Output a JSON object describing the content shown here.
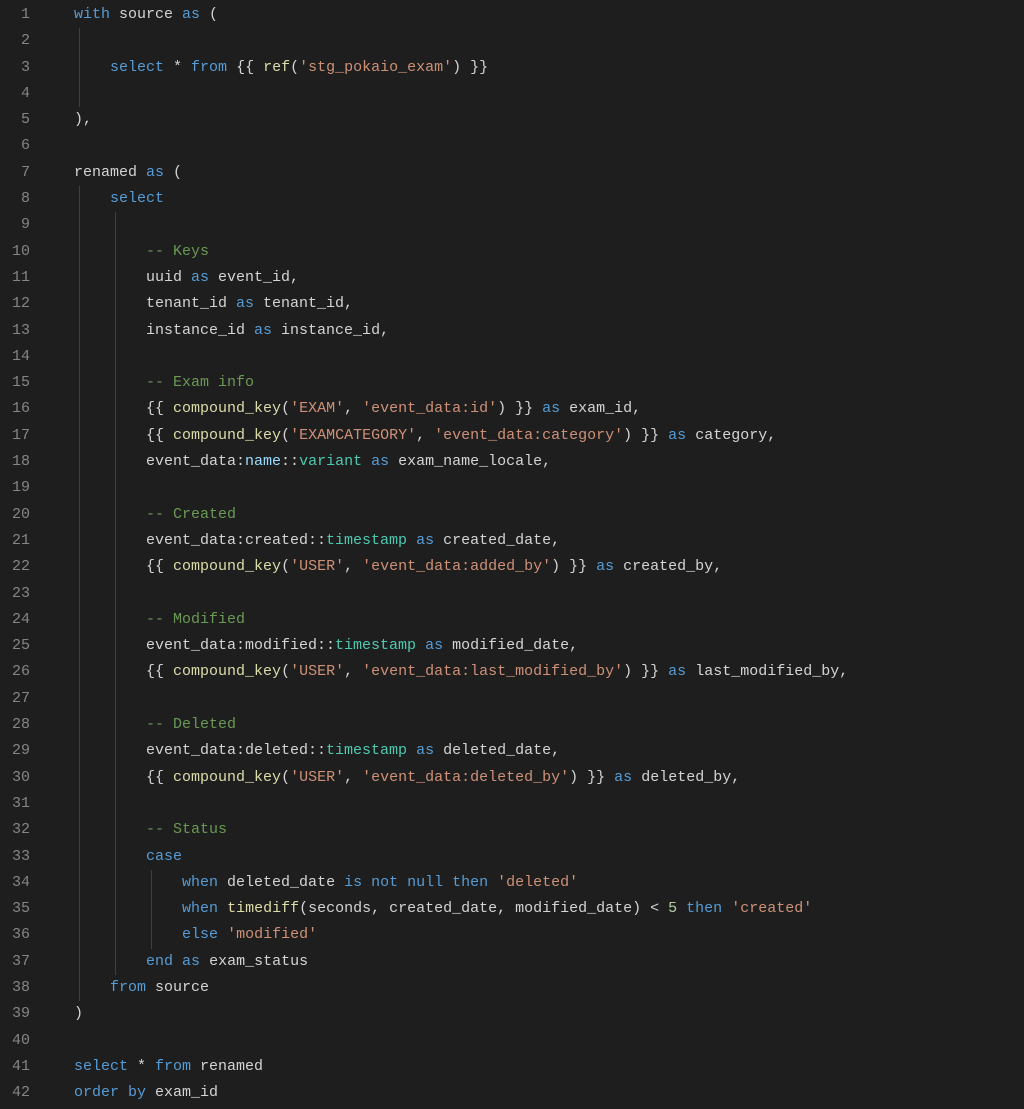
{
  "lineCount": 42,
  "lines": [
    [
      [
        "kw",
        "with"
      ],
      [
        "dim",
        " source "
      ],
      [
        "kw",
        "as"
      ],
      [
        "dim",
        " ("
      ]
    ],
    [],
    [
      [
        "dim",
        "    "
      ],
      [
        "kw",
        "select"
      ],
      [
        "dim",
        " * "
      ],
      [
        "kw",
        "from"
      ],
      [
        "dim",
        " {{ "
      ],
      [
        "fn",
        "ref"
      ],
      [
        "dim",
        "("
      ],
      [
        "str",
        "'stg_pokaio_exam'"
      ],
      [
        "dim",
        ") }}"
      ]
    ],
    [],
    [
      [
        "dim",
        "),"
      ]
    ],
    [],
    [
      [
        "dim",
        "renamed "
      ],
      [
        "kw",
        "as"
      ],
      [
        "dim",
        " ("
      ]
    ],
    [
      [
        "dim",
        "    "
      ],
      [
        "kw",
        "select"
      ]
    ],
    [],
    [
      [
        "dim",
        "        "
      ],
      [
        "cm",
        "-- Keys"
      ]
    ],
    [
      [
        "dim",
        "        uuid "
      ],
      [
        "kw",
        "as"
      ],
      [
        "dim",
        " event_id,"
      ]
    ],
    [
      [
        "dim",
        "        tenant_id "
      ],
      [
        "kw",
        "as"
      ],
      [
        "dim",
        " tenant_id,"
      ]
    ],
    [
      [
        "dim",
        "        instance_id "
      ],
      [
        "kw",
        "as"
      ],
      [
        "dim",
        " instance_id,"
      ]
    ],
    [],
    [
      [
        "dim",
        "        "
      ],
      [
        "cm",
        "-- Exam info"
      ]
    ],
    [
      [
        "dim",
        "        {{ "
      ],
      [
        "fn",
        "compound_key"
      ],
      [
        "dim",
        "("
      ],
      [
        "str",
        "'EXAM'"
      ],
      [
        "dim",
        ", "
      ],
      [
        "str",
        "'event_data:id'"
      ],
      [
        "dim",
        ") }} "
      ],
      [
        "kw",
        "as"
      ],
      [
        "dim",
        " exam_id,"
      ]
    ],
    [
      [
        "dim",
        "        {{ "
      ],
      [
        "fn",
        "compound_key"
      ],
      [
        "dim",
        "("
      ],
      [
        "str",
        "'EXAMCATEGORY'"
      ],
      [
        "dim",
        ", "
      ],
      [
        "str",
        "'event_data:category'"
      ],
      [
        "dim",
        ") }} "
      ],
      [
        "kw",
        "as"
      ],
      [
        "dim",
        " category,"
      ]
    ],
    [
      [
        "dim",
        "        event_data:"
      ],
      [
        "field",
        "name"
      ],
      [
        "dim",
        "::"
      ],
      [
        "type",
        "variant"
      ],
      [
        "dim",
        " "
      ],
      [
        "kw",
        "as"
      ],
      [
        "dim",
        " exam_name_locale,"
      ]
    ],
    [],
    [
      [
        "dim",
        "        "
      ],
      [
        "cm",
        "-- Created"
      ]
    ],
    [
      [
        "dim",
        "        event_data:created::"
      ],
      [
        "type",
        "timestamp"
      ],
      [
        "dim",
        " "
      ],
      [
        "kw",
        "as"
      ],
      [
        "dim",
        " created_date,"
      ]
    ],
    [
      [
        "dim",
        "        {{ "
      ],
      [
        "fn",
        "compound_key"
      ],
      [
        "dim",
        "("
      ],
      [
        "str",
        "'USER'"
      ],
      [
        "dim",
        ", "
      ],
      [
        "str",
        "'event_data:added_by'"
      ],
      [
        "dim",
        ") }} "
      ],
      [
        "kw",
        "as"
      ],
      [
        "dim",
        " created_by,"
      ]
    ],
    [],
    [
      [
        "dim",
        "        "
      ],
      [
        "cm",
        "-- Modified"
      ]
    ],
    [
      [
        "dim",
        "        event_data:modified::"
      ],
      [
        "type",
        "timestamp"
      ],
      [
        "dim",
        " "
      ],
      [
        "kw",
        "as"
      ],
      [
        "dim",
        " modified_date,"
      ]
    ],
    [
      [
        "dim",
        "        {{ "
      ],
      [
        "fn",
        "compound_key"
      ],
      [
        "dim",
        "("
      ],
      [
        "str",
        "'USER'"
      ],
      [
        "dim",
        ", "
      ],
      [
        "str",
        "'event_data:last_modified_by'"
      ],
      [
        "dim",
        ") }} "
      ],
      [
        "kw",
        "as"
      ],
      [
        "dim",
        " last_modified_by,"
      ]
    ],
    [],
    [
      [
        "dim",
        "        "
      ],
      [
        "cm",
        "-- Deleted"
      ]
    ],
    [
      [
        "dim",
        "        event_data:deleted::"
      ],
      [
        "type",
        "timestamp"
      ],
      [
        "dim",
        " "
      ],
      [
        "kw",
        "as"
      ],
      [
        "dim",
        " deleted_date,"
      ]
    ],
    [
      [
        "dim",
        "        {{ "
      ],
      [
        "fn",
        "compound_key"
      ],
      [
        "dim",
        "("
      ],
      [
        "str",
        "'USER'"
      ],
      [
        "dim",
        ", "
      ],
      [
        "str",
        "'event_data:deleted_by'"
      ],
      [
        "dim",
        ") }} "
      ],
      [
        "kw",
        "as"
      ],
      [
        "dim",
        " deleted_by,"
      ]
    ],
    [],
    [
      [
        "dim",
        "        "
      ],
      [
        "cm",
        "-- Status"
      ]
    ],
    [
      [
        "dim",
        "        "
      ],
      [
        "kw",
        "case"
      ]
    ],
    [
      [
        "dim",
        "            "
      ],
      [
        "kw",
        "when"
      ],
      [
        "dim",
        " deleted_date "
      ],
      [
        "kw",
        "is not null then"
      ],
      [
        "dim",
        " "
      ],
      [
        "str",
        "'deleted'"
      ]
    ],
    [
      [
        "dim",
        "            "
      ],
      [
        "kw",
        "when"
      ],
      [
        "dim",
        " "
      ],
      [
        "fn",
        "timediff"
      ],
      [
        "dim",
        "(seconds, created_date, modified_date) < "
      ],
      [
        "num",
        "5"
      ],
      [
        "dim",
        " "
      ],
      [
        "kw",
        "then"
      ],
      [
        "dim",
        " "
      ],
      [
        "str",
        "'created'"
      ]
    ],
    [
      [
        "dim",
        "            "
      ],
      [
        "kw",
        "else"
      ],
      [
        "dim",
        " "
      ],
      [
        "str",
        "'modified'"
      ]
    ],
    [
      [
        "dim",
        "        "
      ],
      [
        "kw",
        "end"
      ],
      [
        "dim",
        " "
      ],
      [
        "kw",
        "as"
      ],
      [
        "dim",
        " exam_status"
      ]
    ],
    [
      [
        "dim",
        "    "
      ],
      [
        "kw",
        "from"
      ],
      [
        "dim",
        " source"
      ]
    ],
    [
      [
        "dim",
        ")"
      ]
    ],
    [],
    [
      [
        "kw",
        "select"
      ],
      [
        "dim",
        " * "
      ],
      [
        "kw",
        "from"
      ],
      [
        "dim",
        " renamed"
      ]
    ],
    [
      [
        "kw",
        "order by"
      ],
      [
        "dim",
        " exam_id"
      ]
    ]
  ],
  "guides": [
    {
      "col": 0.5,
      "from": 2,
      "to": 4
    },
    {
      "col": 0.5,
      "from": 8,
      "to": 38
    },
    {
      "col": 4.5,
      "from": 9,
      "to": 37
    },
    {
      "col": 8.5,
      "from": 34,
      "to": 36
    }
  ],
  "charWidth": 9.02,
  "lineHeight": 26.3,
  "baseIndent": 22
}
